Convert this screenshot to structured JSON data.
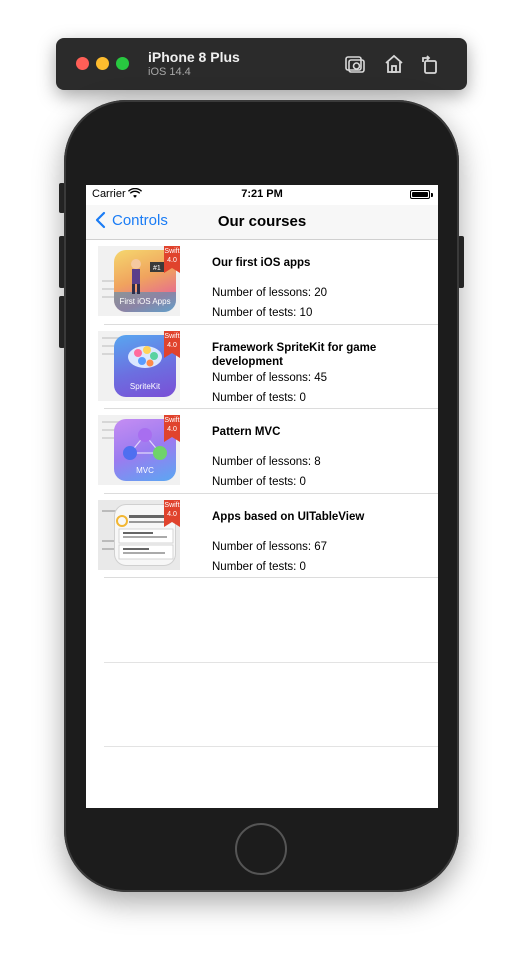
{
  "simulator": {
    "device": "iPhone 8 Plus",
    "os": "iOS 14.4",
    "buttons": [
      "screenshot-icon",
      "home-icon",
      "rotate-icon"
    ]
  },
  "status_bar": {
    "carrier": "Carrier",
    "time": "7:21 PM"
  },
  "nav": {
    "back_label": "Controls",
    "title": "Our courses"
  },
  "colors": {
    "accent": "#1a7cf5",
    "ribbon": "#e0432d"
  },
  "courses": [
    {
      "title": "Our first iOS apps",
      "icon_text": "First iOS Apps",
      "badge": "Swift 4.0",
      "lessons": "Number of lessons: 20",
      "tests": "Number of tests: 10"
    },
    {
      "title": "Framework SpriteKit for game development",
      "icon_text": "SpriteKit",
      "badge": "Swift 4.0",
      "lessons": "Number of lessons: 45",
      "tests": "Number of tests: 0"
    },
    {
      "title": "Pattern MVC",
      "icon_text": "MVC",
      "badge": "Swift 4.0",
      "lessons": "Number of lessons: 8",
      "tests": "Number of tests: 0"
    },
    {
      "title": "Apps based on UITableView",
      "icon_text": "",
      "badge": "Swift 4.0",
      "lessons": "Number of lessons: 67",
      "tests": "Number of tests: 0"
    }
  ]
}
